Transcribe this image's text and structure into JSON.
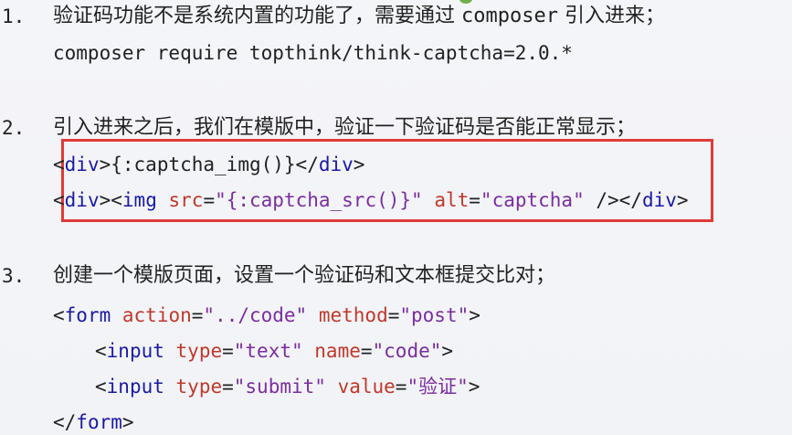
{
  "step1": {
    "num": "1.",
    "title_a": "验证码功能不是系统内置的功能了，需要通过 ",
    "title_code": "composer",
    "title_b": " 引入进来；",
    "command": "composer require topthink/think-captcha=2.0.*"
  },
  "step2": {
    "num": "2.",
    "title": "引入进来之后，我们在模版中，验证一下验证码是否能正常显示；",
    "code1": {
      "lt": "<",
      "tag_open": "div",
      "gt": ">",
      "content": "{:captcha_img()}",
      "close_lt": "</",
      "tag_close": "div",
      "close_gt": ">"
    },
    "code2": {
      "lt": "<",
      "div_open": "div",
      "gt1": ">",
      "lt2": "<",
      "img": "img",
      "src_attr": "src",
      "eq1": "=",
      "src_val": "\"{:captcha_src()}\"",
      "alt_attr": "alt",
      "eq2": "=",
      "alt_val": "\"captcha\"",
      "self_close": " />",
      "close_lt": "</",
      "div_close": "div",
      "close_gt": ">"
    }
  },
  "step3": {
    "num": "3.",
    "title": "创建一个模版页面，设置一个验证码和文本框提交比对；",
    "form_open": {
      "lt": "<",
      "tag": "form",
      "action_attr": "action",
      "eq1": "=",
      "action_val": "\"../code\"",
      "method_attr": "method",
      "eq2": "=",
      "method_val": "\"post\"",
      "gt": ">"
    },
    "input1": {
      "lt": "<",
      "tag": "input",
      "type_attr": "type",
      "eq1": "=",
      "type_val": "\"text\"",
      "name_attr": "name",
      "eq2": "=",
      "name_val": "\"code\"",
      "gt": ">"
    },
    "input2": {
      "lt": "<",
      "tag": "input",
      "type_attr": "type",
      "eq1": "=",
      "type_val": "\"submit\"",
      "value_attr": "value",
      "eq2": "=",
      "value_val": "\"验证\"",
      "gt": ">"
    },
    "form_close": {
      "lt": "</",
      "tag": "form",
      "gt": ">"
    }
  },
  "colors": {
    "tag": "#1a1aa6",
    "attr": "#c0392b",
    "value": "#7a2ea0",
    "highlight_box": "#e03a3a"
  }
}
